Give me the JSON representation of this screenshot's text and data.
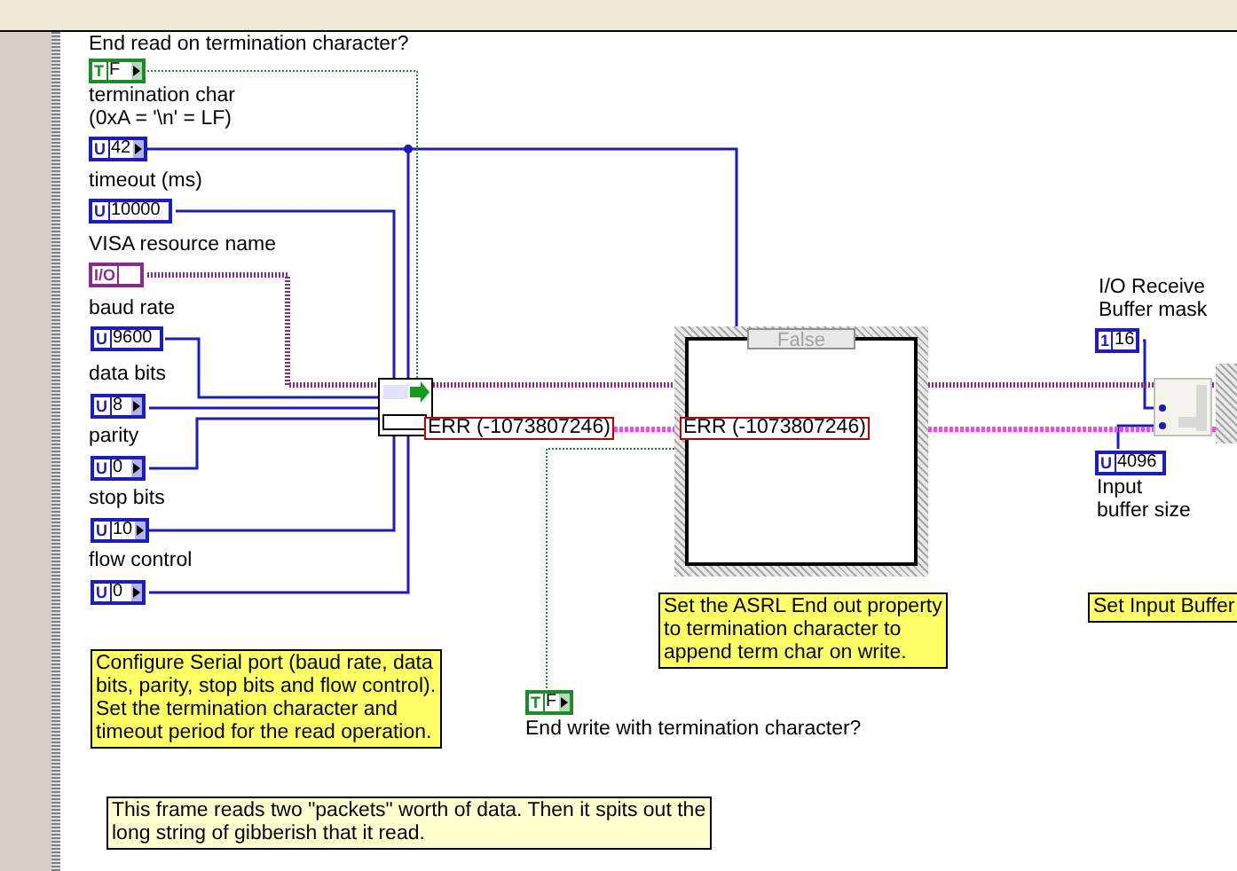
{
  "terminals": [
    {
      "label_lines": [
        "End read on termination character?"
      ],
      "kind": "bool",
      "type_label": "T",
      "value": "F"
    },
    {
      "label_lines": [
        "termination char",
        "(0xA = '\\n' = LF)"
      ],
      "kind": "numeric",
      "type_label": "U",
      "value": "42"
    },
    {
      "label_lines": [
        "timeout (ms)"
      ],
      "kind": "numeric",
      "type_label": "U",
      "value": "10000"
    },
    {
      "label_lines": [
        "VISA resource name"
      ],
      "kind": "resource",
      "type_label": "I/O"
    },
    {
      "label_lines": [
        "baud rate"
      ],
      "kind": "numeric",
      "type_label": "U",
      "value": "9600"
    },
    {
      "label_lines": [
        "data bits"
      ],
      "kind": "numeric",
      "type_label": "U",
      "value": "8"
    },
    {
      "label_lines": [
        "parity"
      ],
      "kind": "numeric",
      "type_label": "U",
      "value": "0"
    },
    {
      "label_lines": [
        "stop bits"
      ],
      "kind": "numeric",
      "type_label": "U",
      "value": "10"
    },
    {
      "label_lines": [
        "flow control"
      ],
      "kind": "numeric",
      "type_label": "U",
      "value": "0"
    },
    {
      "label_lines": [
        "End write with termination character?"
      ],
      "kind": "bool",
      "type_label": "T",
      "value": "F"
    },
    {
      "label_lines": [
        "I/O Receive",
        "Buffer mask"
      ],
      "kind": "numeric",
      "type_label": "1",
      "value": "16"
    },
    {
      "label_lines": [
        "Input",
        "buffer size"
      ],
      "kind": "numeric",
      "type_label": "U",
      "value": "4096"
    }
  ],
  "error_indicators": [
    {
      "text": "ERR (-1073807246)"
    },
    {
      "text": "ERR (-1073807246)"
    }
  ],
  "case_structure": {
    "selector": "False"
  },
  "notes": [
    {
      "kind": "note",
      "lines": [
        "Set the ASRL End out property",
        "to termination character to",
        "append term char on write."
      ]
    },
    {
      "kind": "note",
      "lines": [
        "Configure Serial port (baud rate, data",
        "bits, parity, stop bits and flow control).",
        "Set the termination character and",
        "timeout period for the read operation."
      ]
    },
    {
      "kind": "note",
      "lines": [
        "Set Input Buffer"
      ]
    },
    {
      "kind": "comment",
      "lines": [
        "This frame reads two \"packets\" worth of data.  Then it spits out the",
        "long string of gibberish that it read."
      ]
    }
  ]
}
